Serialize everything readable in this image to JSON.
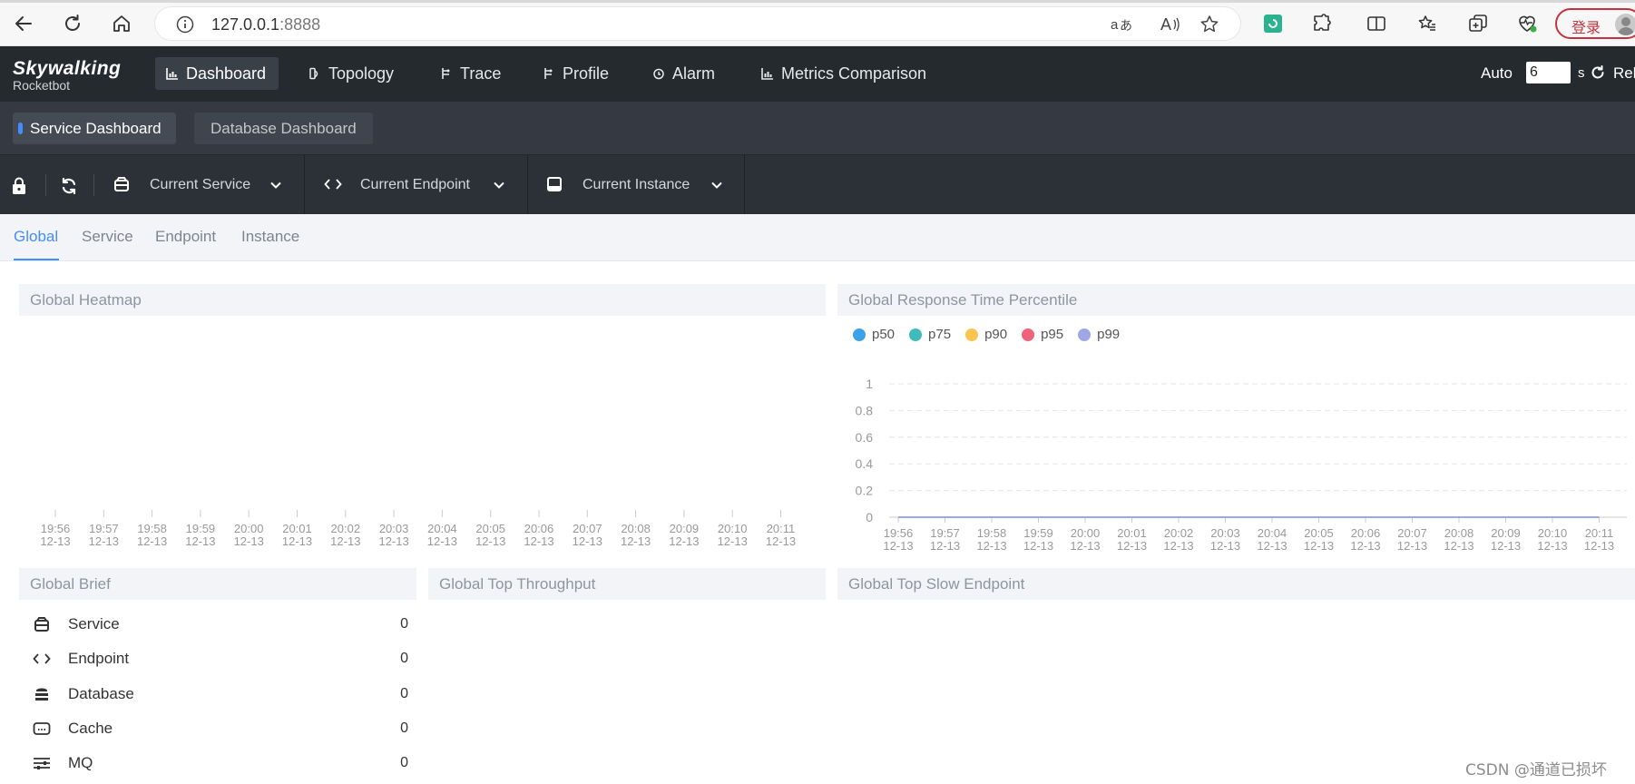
{
  "browser": {
    "url_host": "127.0.0.1",
    "url_port": ":8888",
    "login_label": "登录"
  },
  "app": {
    "logo_title": "Skywalking",
    "logo_subtitle": "Rocketbot",
    "nav": [
      {
        "label": "Dashboard",
        "icon": "chart-icon"
      },
      {
        "label": "Topology",
        "icon": "topology-icon"
      },
      {
        "label": "Trace",
        "icon": "trace-icon"
      },
      {
        "label": "Profile",
        "icon": "profile-icon"
      },
      {
        "label": "Alarm",
        "icon": "alarm-icon"
      },
      {
        "label": "Metrics Comparison",
        "icon": "chart-icon"
      }
    ],
    "auto_label": "Auto",
    "auto_value": "6",
    "auto_unit": "s",
    "reload_label": "Rel"
  },
  "dashboards": {
    "tabs": [
      "Service Dashboard",
      "Database Dashboard"
    ]
  },
  "selectors": {
    "service_label": "Current Service",
    "endpoint_label": "Current Endpoint",
    "instance_label": "Current Instance"
  },
  "sub_tabs": [
    "Global",
    "Service",
    "Endpoint",
    "Instance"
  ],
  "panels": {
    "heatmap_title": "Global Heatmap",
    "percentile_title": "Global Response Time Percentile",
    "brief_title": "Global Brief",
    "throughput_title": "Global Top Throughput",
    "slow_title": "Global Top Slow Endpoint"
  },
  "chart_data": [
    {
      "type": "heatmap",
      "title": "Global Heatmap",
      "x_times": [
        "19:56",
        "19:57",
        "19:58",
        "19:59",
        "20:00",
        "20:01",
        "20:02",
        "20:03",
        "20:04",
        "20:05",
        "20:06",
        "20:07",
        "20:08",
        "20:09",
        "20:10",
        "20:11"
      ],
      "x_date": "12-13",
      "values": []
    },
    {
      "type": "line",
      "title": "Global Response Time Percentile",
      "x_times": [
        "19:56",
        "19:57",
        "19:58",
        "19:59",
        "20:00",
        "20:01",
        "20:02",
        "20:03",
        "20:04",
        "20:05",
        "20:06",
        "20:07",
        "20:08",
        "20:09",
        "20:10",
        "20:11"
      ],
      "x_date": "12-13",
      "y_ticks": [
        "0",
        "0.2",
        "0.4",
        "0.6",
        "0.8",
        "1"
      ],
      "ylim": [
        0,
        1
      ],
      "grid": true,
      "legend_position": "top-left",
      "series": [
        {
          "name": "p50",
          "color": "#3ba1e8",
          "values": [
            0,
            0,
            0,
            0,
            0,
            0,
            0,
            0,
            0,
            0,
            0,
            0,
            0,
            0,
            0,
            0
          ]
        },
        {
          "name": "p75",
          "color": "#3fbbbb",
          "values": [
            0,
            0,
            0,
            0,
            0,
            0,
            0,
            0,
            0,
            0,
            0,
            0,
            0,
            0,
            0,
            0
          ]
        },
        {
          "name": "p90",
          "color": "#f8c550",
          "values": [
            0,
            0,
            0,
            0,
            0,
            0,
            0,
            0,
            0,
            0,
            0,
            0,
            0,
            0,
            0,
            0
          ]
        },
        {
          "name": "p95",
          "color": "#f0637c",
          "values": [
            0,
            0,
            0,
            0,
            0,
            0,
            0,
            0,
            0,
            0,
            0,
            0,
            0,
            0,
            0,
            0
          ]
        },
        {
          "name": "p99",
          "color": "#a0a7e6",
          "values": [
            0,
            0,
            0,
            0,
            0,
            0,
            0,
            0,
            0,
            0,
            0,
            0,
            0,
            0,
            0,
            0
          ]
        }
      ]
    }
  ],
  "brief": [
    {
      "name": "Service",
      "value": "0",
      "icon": "service-icon"
    },
    {
      "name": "Endpoint",
      "value": "0",
      "icon": "endpoint-icon"
    },
    {
      "name": "Database",
      "value": "0",
      "icon": "database-icon"
    },
    {
      "name": "Cache",
      "value": "0",
      "icon": "cache-icon"
    },
    {
      "name": "MQ",
      "value": "0",
      "icon": "mq-icon"
    }
  ],
  "watermark": "CSDN @通道已损坏"
}
